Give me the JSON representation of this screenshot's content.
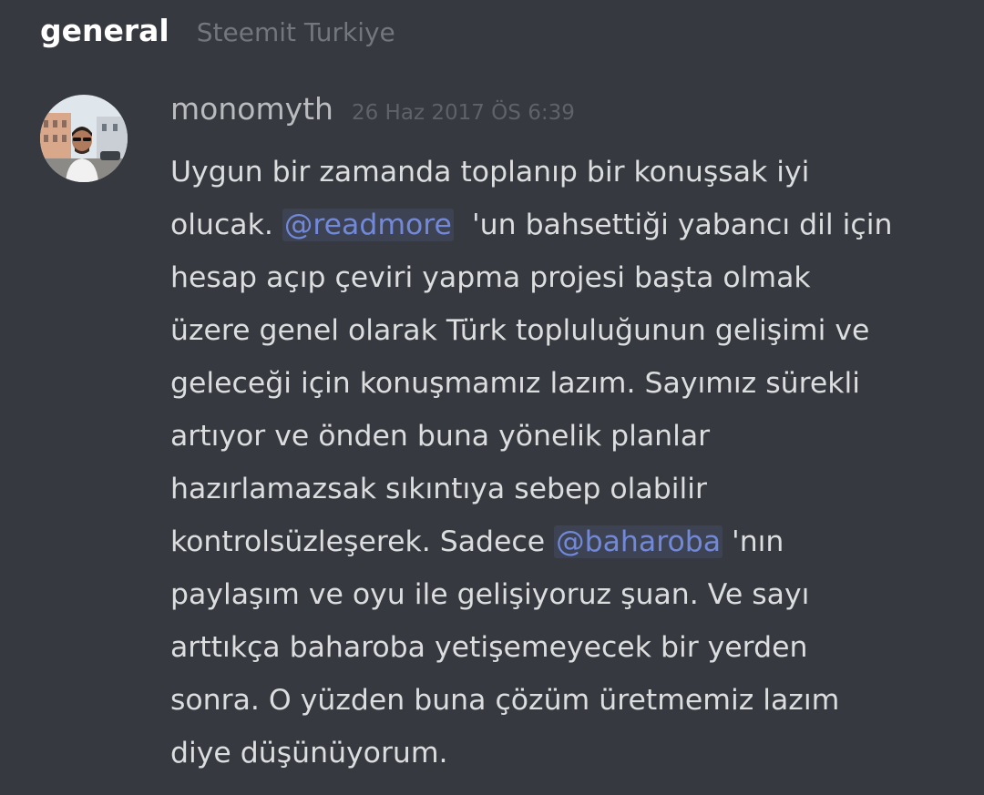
{
  "header": {
    "channel": "general",
    "server": "Steemit Turkiye"
  },
  "message": {
    "author": "monomyth",
    "timestamp": "26 Haz 2017 ÖS 6:39",
    "lines": [
      [
        {
          "text": "Uygun bir zamanda toplanıp bir konuşsak iyi"
        }
      ],
      [
        {
          "text": "olucak. "
        },
        {
          "mention": "@readmore"
        },
        {
          "text": "  'un bahsettiği yabancı dil için"
        }
      ],
      [
        {
          "text": "hesap açıp çeviri yapma projesi başta olmak"
        }
      ],
      [
        {
          "text": "üzere genel olarak Türk topluluğunun gelişimi ve"
        }
      ],
      [
        {
          "text": "geleceği için konuşmamız lazım. Sayımız sürekli"
        }
      ],
      [
        {
          "text": "artıyor ve önden buna yönelik planlar"
        }
      ],
      [
        {
          "text": "hazırlamazsak sıkıntıya sebep olabilir"
        }
      ],
      [
        {
          "text": "kontrolsüzleşerek. Sadece "
        },
        {
          "mention": "@baharoba"
        },
        {
          "text": " 'nın"
        }
      ],
      [
        {
          "text": "paylaşım ve oyu ile gelişiyoruz şuan. Ve sayı"
        }
      ],
      [
        {
          "text": "arttıkça baharoba yetişemeyecek bir yerden"
        }
      ],
      [
        {
          "text": "sonra. O yüzden buna çözüm üretmemiz lazım"
        }
      ],
      [
        {
          "text": "diye düşünüyorum."
        }
      ]
    ]
  },
  "colors": {
    "background": "#36393f",
    "mention": "#7289da",
    "text": "#dcddde"
  },
  "icons": {
    "avatar": "user-avatar-photo"
  }
}
